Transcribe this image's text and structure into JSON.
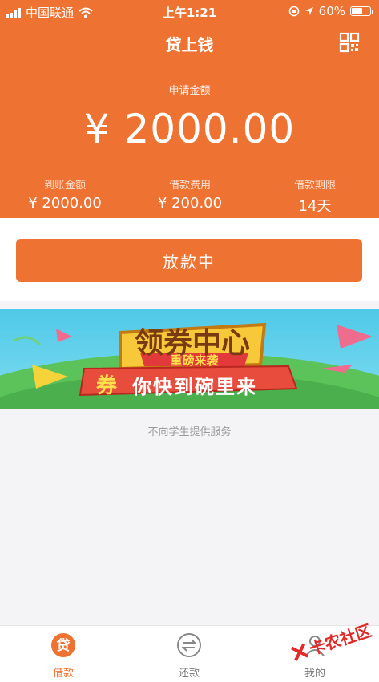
{
  "status_bar": {
    "carrier": "中国联通",
    "time": "上午1:21",
    "battery": "60%",
    "battery_level": 0.6
  },
  "nav": {
    "title": "贷上钱"
  },
  "loan": {
    "apply_label": "申请金额",
    "apply_amount": "¥ 2000.00",
    "stats": [
      {
        "label": "到账金额",
        "value": "¥ 2000.00"
      },
      {
        "label": "借款费用",
        "value": "¥ 200.00"
      },
      {
        "label": "借款期限",
        "value": "14天"
      }
    ]
  },
  "action_button": "放款中",
  "banner": {
    "title": "领券中心",
    "ribbon": "重磅来袭",
    "strip_icon": "券",
    "strip_text": "你快到碗里来"
  },
  "note": "不向学生提供服务",
  "tabs": [
    {
      "label": "借款",
      "icon": "loan-icon"
    },
    {
      "label": "还款",
      "icon": "repay-icon"
    },
    {
      "label": "我的",
      "icon": "profile-icon"
    }
  ],
  "watermark": "卡农社区",
  "colors": {
    "accent": "#ee7231"
  }
}
